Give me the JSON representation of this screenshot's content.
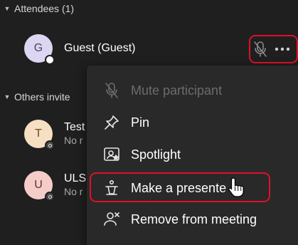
{
  "attendees_section": {
    "title": "Attendees (1)"
  },
  "others_section": {
    "title": "Others invite"
  },
  "guest": {
    "initial": "G",
    "name": "Guest (Guest)"
  },
  "others": [
    {
      "initial": "T",
      "name": "Test",
      "status": "No r"
    },
    {
      "initial": "U",
      "name": "ULS",
      "status": "No r"
    }
  ],
  "row_actions": {
    "mic_icon": "mic-off-icon",
    "more_icon": "more-options-icon"
  },
  "context_menu": {
    "items": [
      {
        "label": "Mute participant",
        "icon": "mic-off-icon",
        "disabled": true
      },
      {
        "label": "Pin",
        "icon": "pin-icon"
      },
      {
        "label": "Spotlight",
        "icon": "spotlight-icon"
      },
      {
        "label": "Make a presente",
        "icon": "presenter-icon"
      },
      {
        "label": "Remove from meeting",
        "icon": "remove-person-icon"
      }
    ]
  },
  "colors": {
    "background": "#1f1f1f",
    "menu": "#292929",
    "highlight": "#e0102a"
  }
}
